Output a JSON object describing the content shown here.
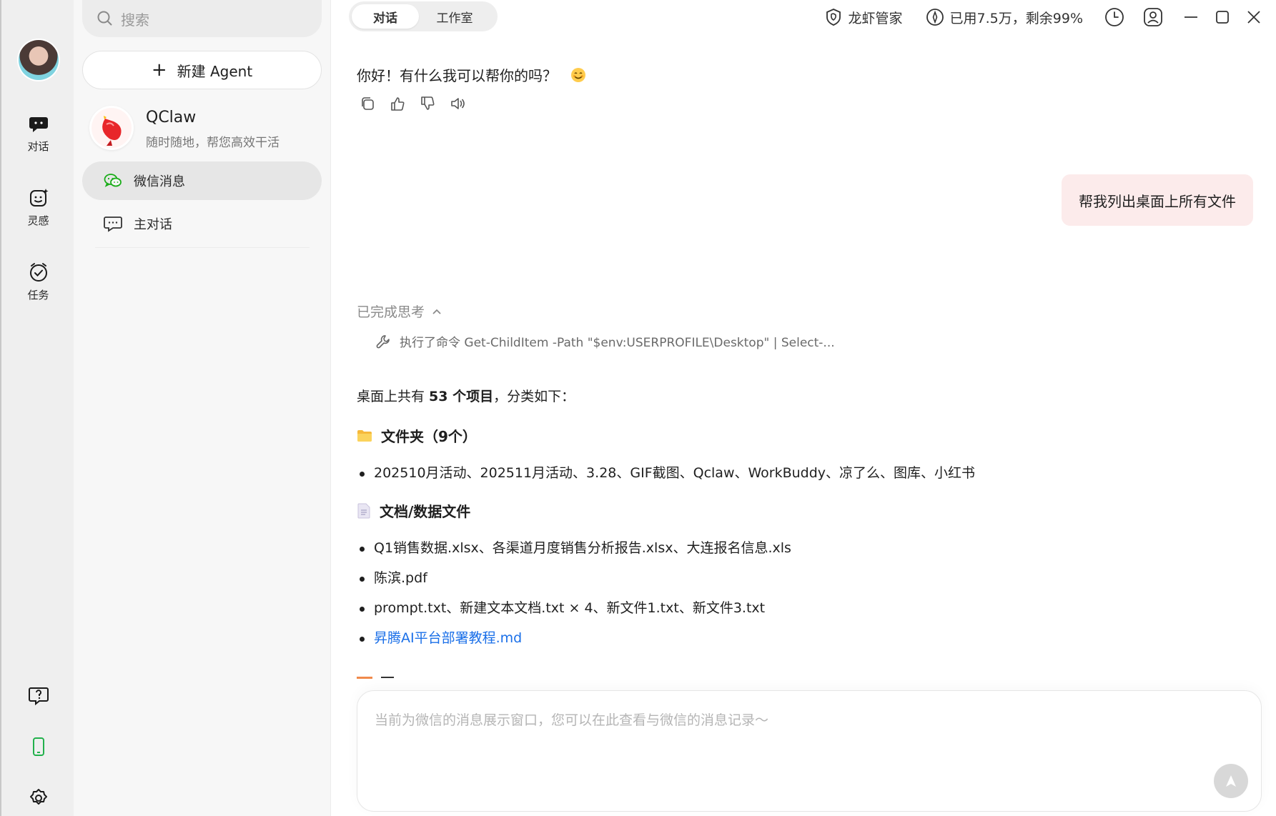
{
  "rail": {
    "items": [
      {
        "label": "对话",
        "icon": "chat-icon"
      },
      {
        "label": "灵感",
        "icon": "inspiration-icon"
      },
      {
        "label": "任务",
        "icon": "task-clock-icon"
      }
    ],
    "bottom_icons": [
      "help-icon",
      "phone-icon",
      "settings-icon"
    ]
  },
  "sidebar": {
    "search_placeholder": "搜索",
    "new_agent_label": "新建 Agent",
    "agent": {
      "name": "QClaw",
      "subtitle": "随时随地，帮您高效干活"
    },
    "conversations": [
      {
        "label": "微信消息",
        "icon": "wechat-icon",
        "active": true
      },
      {
        "label": "主对话",
        "icon": "chat-bubble-icon",
        "active": false
      }
    ]
  },
  "topbar": {
    "tabs": [
      {
        "label": "对话",
        "active": true
      },
      {
        "label": "工作室",
        "active": false
      }
    ],
    "manager_label": "龙虾管家",
    "usage_label": "已用7.5万，剩余99%"
  },
  "chat": {
    "greeting": "你好！有什么我可以帮你的吗？",
    "user_message": "帮我列出桌面上所有文件",
    "thinking_label": "已完成思考",
    "tool_call": "执行了命令 Get-ChildItem -Path \"$env:USERPROFILE\\Desktop\" | Select-...",
    "summary_prefix": "桌面上共有 ",
    "summary_count": "53 个项目",
    "summary_suffix": "，分类如下：",
    "sections": [
      {
        "title": "文件夹（9个）",
        "icon": "folder-icon",
        "items": [
          "202510月活动、202511月活动、3.28、GIF截图、Qclaw、WorkBuddy、凉了么、图库、小红书"
        ]
      },
      {
        "title": "文档/数据文件",
        "icon": "document-icon",
        "items": [
          "Q1销售数据.xlsx、各渠道月度销售分析报告.xlsx、大连报名信息.xls",
          "陈滨.pdf",
          "prompt.txt、新建文本文档.txt × 4、新文件1.txt、新文件3.txt"
        ],
        "link": "昇腾AI平台部署教程.md"
      }
    ]
  },
  "input": {
    "placeholder": "当前为微信的消息展示窗口，您可以在此查看与微信的消息记录～"
  },
  "colors": {
    "accent_link": "#1a6fe8",
    "user_bubble": "#fcebeb",
    "wechat_green": "#1aad19",
    "phone_green": "#22b14c"
  }
}
